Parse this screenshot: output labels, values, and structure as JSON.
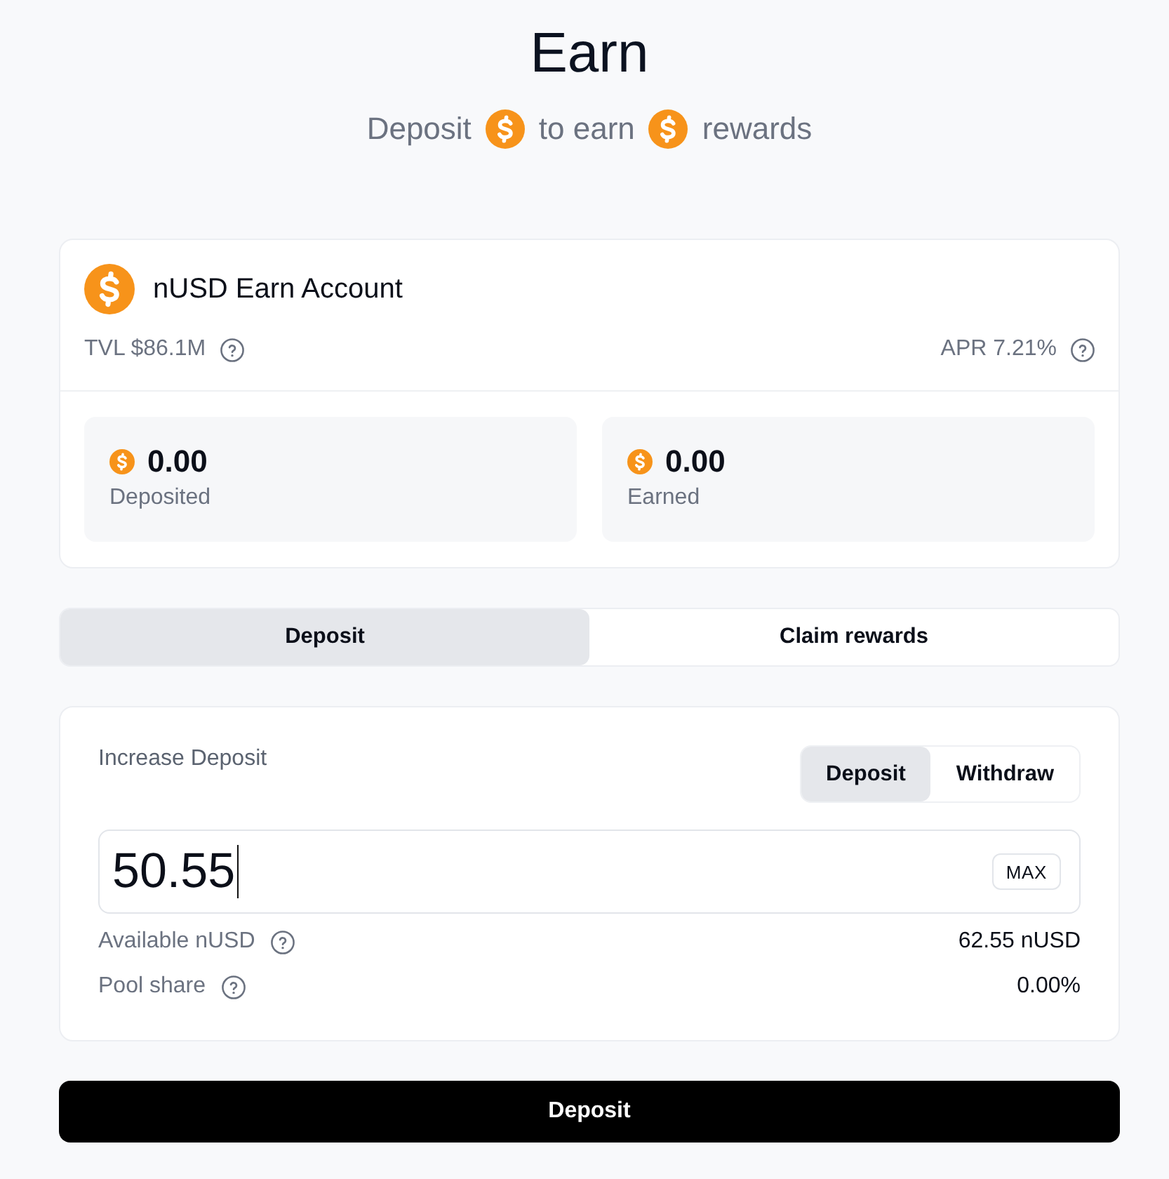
{
  "header": {
    "title": "Earn",
    "subtitle": [
      {
        "kind": "text",
        "text": "Deposit"
      },
      {
        "kind": "coin"
      },
      {
        "kind": "text",
        "text": "to earn"
      },
      {
        "kind": "coin"
      },
      {
        "kind": "text",
        "text": "rewards"
      }
    ]
  },
  "account": {
    "title": "nUSD Earn Account",
    "tvl": "TVL $86.1M",
    "apr": "APR 7.21%",
    "stats": [
      {
        "value": "0.00",
        "label": "Deposited"
      },
      {
        "value": "0.00",
        "label": "Earned"
      }
    ]
  },
  "tabs": [
    {
      "label": "Deposit",
      "selected": true
    },
    {
      "label": "Claim rewards",
      "selected": false
    }
  ],
  "form": {
    "title": "Increase Deposit",
    "modes": [
      {
        "label": "Deposit",
        "selected": true
      },
      {
        "label": "Withdraw",
        "selected": false
      }
    ],
    "amount": {
      "value": "50.55",
      "focused": true
    },
    "max_button": "MAX",
    "details": [
      {
        "label": "Available nUSD",
        "value": "62.55 nUSD"
      },
      {
        "label": "Pool share",
        "value": "0.00%"
      }
    ]
  },
  "submit_button": "Deposit"
}
